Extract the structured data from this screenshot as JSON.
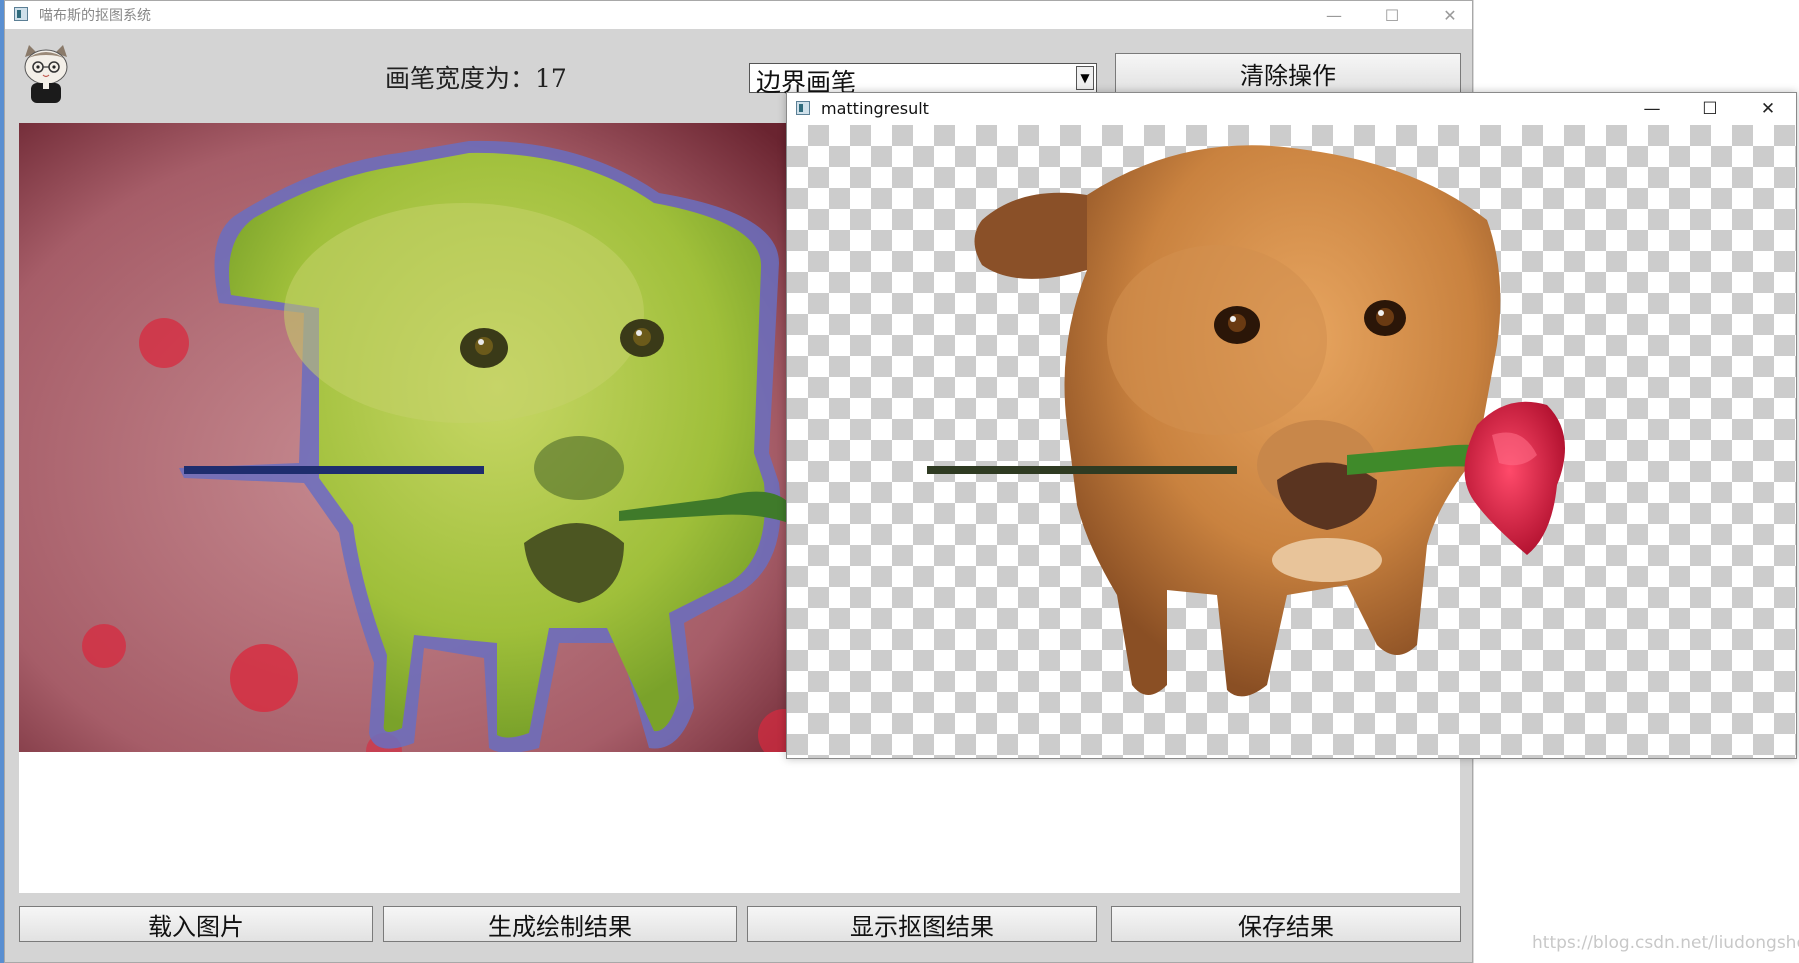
{
  "main_window": {
    "title": "喵布斯的抠图系统",
    "brush_width_label": "画笔宽度为：17",
    "mode_select": {
      "selected": "边界画笔"
    },
    "clear_button": "清除操作",
    "buttons": {
      "load": "载入图片",
      "generate": "生成绘制结果",
      "show": "显示抠图结果",
      "save": "保存结果"
    }
  },
  "result_window": {
    "title": "mattingresult"
  },
  "watermark": "https://blog.csdn.net/liudongshengcn",
  "icons": {
    "minimize": "minimize-icon",
    "maximize": "maximize-icon",
    "close": "close-icon",
    "avatar": "cat-avatar-icon"
  },
  "colors": {
    "overlay_green": "#b5d24a",
    "boundary_blue": "#6a6fc0",
    "background_pink": "#b9707a",
    "dog_fur": "#c9823f",
    "rose": "#d81e45"
  }
}
